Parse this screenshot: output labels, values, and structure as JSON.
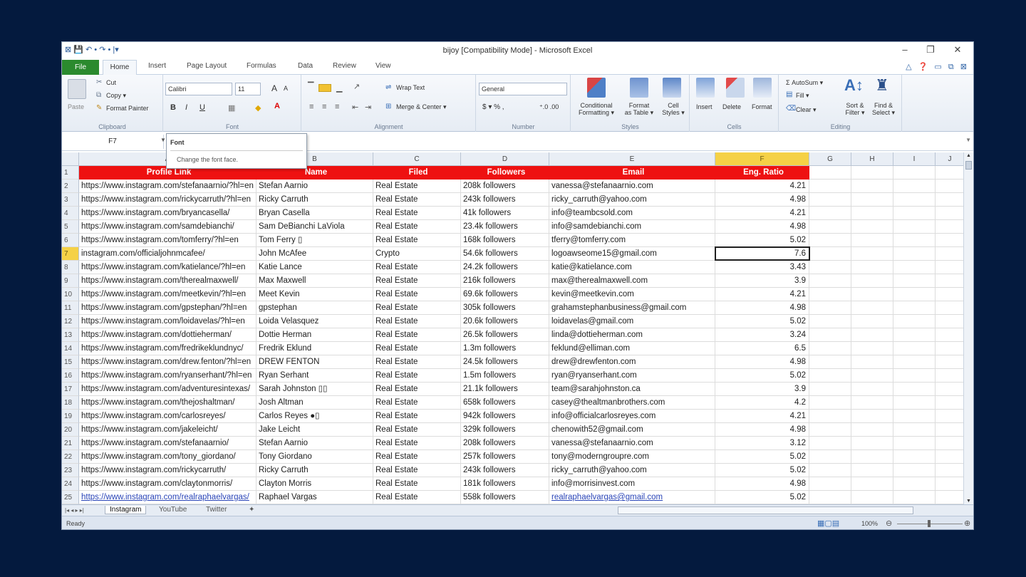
{
  "window": {
    "title": "bijoy  [Compatibility Mode] - Microsoft Excel",
    "quick_access": "⊠ 💾 ↶ • ↷ • |▾",
    "controls": {
      "minimize": "–",
      "restore": "❐",
      "close": "✕"
    }
  },
  "tabs": {
    "file": "File",
    "home": "Home",
    "items": [
      "Insert",
      "Page Layout",
      "Formulas",
      "Data",
      "Review",
      "View"
    ],
    "right_icons": "△ ❓ ▭ ⧉ ⊠"
  },
  "ribbon": {
    "clipboard": {
      "label": "Clipboard",
      "paste": "Paste",
      "cut": "Cut",
      "copy": "Copy ▾",
      "format_painter": "Format Painter"
    },
    "font": {
      "label": "Font",
      "name": "Calibri",
      "size": "11",
      "grow": "A",
      "shrink": "A",
      "bold": "B",
      "italic": "I",
      "underline": "U"
    },
    "alignment": {
      "label": "Alignment",
      "wrap": "Wrap Text",
      "merge": "Merge & Center ▾"
    },
    "number": {
      "label": "Number",
      "format": "General",
      "currency": "$ ▾ % ,",
      "dec": "⁺.0 .00"
    },
    "styles": {
      "label": "Styles",
      "conditional": "Conditional\nFormatting ▾",
      "format_table": "Format\nas Table ▾",
      "cell_styles": "Cell\nStyles ▾"
    },
    "cells": {
      "label": "Cells",
      "insert": "Insert",
      "delete": "Delete",
      "format": "Format"
    },
    "editing": {
      "label": "Editing",
      "autosum": "Σ AutoSum ▾",
      "fill": "Fill ▾",
      "clear": "Clear ▾",
      "sort": "Sort &\nFilter ▾",
      "find": "Find &\nSelect ▾"
    }
  },
  "formula_bar": {
    "name_box": "F7",
    "tooltip_title": "Font",
    "tooltip_desc": "Change the font face."
  },
  "columns": [
    "A",
    "B",
    "C",
    "D",
    "E",
    "F",
    "G",
    "H",
    "I",
    "J"
  ],
  "headers": [
    "Profile Link",
    "Name",
    "Filed",
    "Followers",
    "Email",
    "Eng. Ratio"
  ],
  "rows": [
    [
      "https://www.instagram.com/stefanaarnio/?hl=en",
      "Stefan Aarnio",
      "Real Estate",
      "208k followers",
      "vanessa@stefanaarnio.com",
      "4.21"
    ],
    [
      "https://www.instagram.com/rickycarruth/?hl=en",
      "Ricky Carruth",
      "Real Estate",
      "243k followers",
      "ricky_carruth@yahoo.com",
      "4.98"
    ],
    [
      "https://www.instagram.com/bryancasella/",
      "Bryan Casella",
      "Real Estate",
      "41k followers",
      "info@teambcsold.com",
      "4.21"
    ],
    [
      "https://www.instagram.com/samdebianchi/",
      "Sam DeBianchi LaViola",
      "Real Estate",
      "23.4k followers",
      "info@samdebianchi.com",
      "4.98"
    ],
    [
      "https://www.instagram.com/tomferry/?hl=en",
      "Tom Ferry ▯",
      "Real Estate",
      "168k followers",
      "tferry@tomferry.com",
      "5.02"
    ],
    [
      "instagram.com/officialjohnmcafee/",
      "John McAfee",
      "Crypto",
      "54.6k followers",
      "logoawseome15@gmail.com",
      "7.6"
    ],
    [
      "https://www.instagram.com/katielance/?hl=en",
      "Katie Lance",
      "Real Estate",
      "24.2k followers",
      "katie@katielance.com",
      "3.43"
    ],
    [
      "https://www.instagram.com/therealmaxwell/",
      "Max Maxwell",
      "Real Estate",
      "216k followers",
      "max@therealmaxwell.com",
      "3.9"
    ],
    [
      "https://www.instagram.com/meetkevin/?hl=en",
      "Meet Kevin",
      "Real Estate",
      "69.6k followers",
      "kevin@meetkevin.com",
      "4.21"
    ],
    [
      "https://www.instagram.com/gpstephan/?hl=en",
      "gpstephan",
      "Real Estate",
      "305k followers",
      "grahamstephanbusiness@gmail.com",
      "4.98"
    ],
    [
      "https://www.instagram.com/loidavelas/?hl=en",
      "Loida Velasquez",
      "Real Estate",
      "20.6k followers",
      "loidavelas@gmail.com",
      "5.02"
    ],
    [
      "https://www.instagram.com/dottieherman/",
      "Dottie Herman",
      "Real Estate",
      "26.5k followers",
      "linda@dottieherman.com",
      "3.24"
    ],
    [
      "https://www.instagram.com/fredrikeklundnyc/",
      "Fredrik Eklund",
      "Real Estate",
      "1.3m followers",
      "feklund@elliman.com",
      "6.5"
    ],
    [
      "https://www.instagram.com/drew.fenton/?hl=en",
      "DREW FENTON",
      "Real Estate",
      "24.5k followers",
      "drew@drewfenton.com",
      "4.98"
    ],
    [
      "https://www.instagram.com/ryanserhant/?hl=en",
      "Ryan Serhant",
      "Real Estate",
      "1.5m followers",
      "ryan@ryanserhant.com",
      "5.02"
    ],
    [
      "https://www.instagram.com/adventuresintexas/",
      "Sarah Johnston ▯▯",
      "Real Estate",
      "21.1k followers",
      "team@sarahjohnston.ca",
      "3.9"
    ],
    [
      "https://www.instagram.com/thejoshaltman/",
      "Josh Altman",
      "Real Estate",
      "658k followers",
      "casey@thealtmanbrothers.com",
      "4.2"
    ],
    [
      "https://www.instagram.com/carlosreyes/",
      "Carlos Reyes ●▯",
      "Real Estate",
      "942k followers",
      "info@officialcarlosreyes.com",
      "4.21"
    ],
    [
      "https://www.instagram.com/jakeleicht/",
      "Jake Leicht",
      "Real Estate",
      "329k followers",
      "chenowith52@gmail.com",
      "4.98"
    ],
    [
      "https://www.instagram.com/stefanaarnio/",
      "Stefan Aarnio",
      "Real Estate",
      "208k followers",
      "vanessa@stefanaarnio.com",
      "3.12"
    ],
    [
      "https://www.instagram.com/tony_giordano/",
      "Tony Giordano",
      "Real Estate",
      "257k followers",
      "tony@moderngroupre.com",
      "5.02"
    ],
    [
      "https://www.instagram.com/rickycarruth/",
      "Ricky Carruth",
      "Real Estate",
      "243k followers",
      "ricky_carruth@yahoo.com",
      "5.02"
    ],
    [
      "https://www.instagram.com/claytonmorris/",
      "Clayton Morris",
      "Real Estate",
      "181k followers",
      "info@morrisinvest.com",
      "4.98"
    ],
    [
      "https://www.instagram.com/realraphaelvargas/",
      "Raphael Vargas",
      "Real Estate",
      "558k followers",
      "realraphaelvargas@gmail.com",
      "5.02"
    ]
  ],
  "sheet_tabs": {
    "nav": "|◂ ◂ ▸ ▸|",
    "tabs": [
      "Instagram",
      "YouTube",
      "Twitter"
    ],
    "new": "✦"
  },
  "status": {
    "ready": "Ready",
    "zoom": "100%",
    "zoom_minus": "⊖",
    "zoom_plus": "⊕"
  },
  "colors": {
    "header_bg": "#ee1111",
    "file_tab": "#2b8a2e",
    "selected_col": "#f5d146"
  }
}
